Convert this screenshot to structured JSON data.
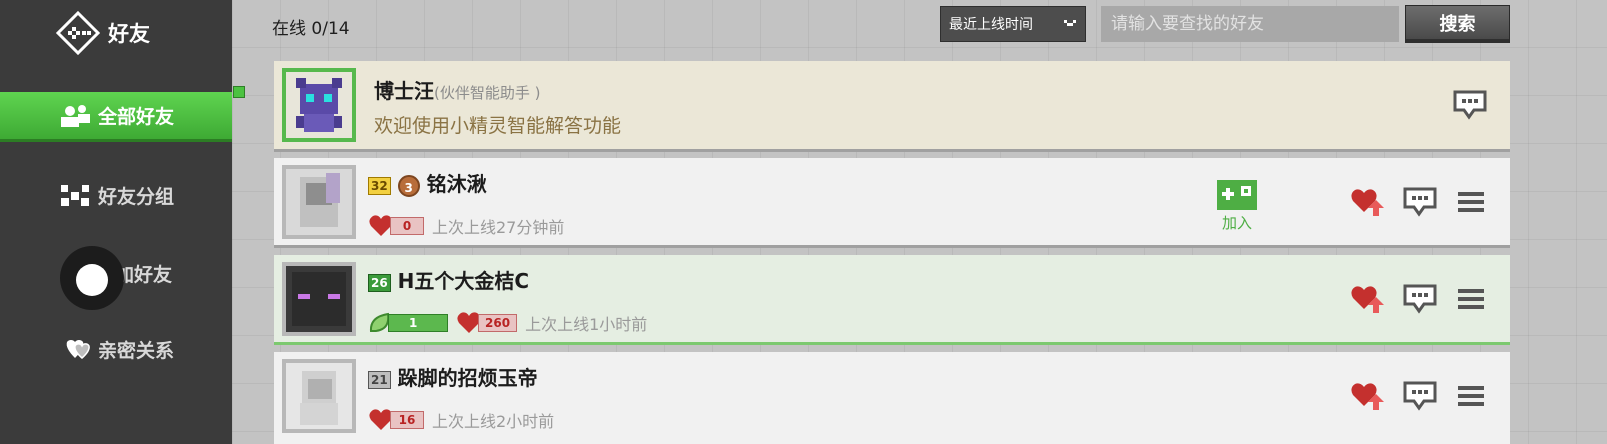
{
  "sidebar": {
    "title": "好友",
    "items": [
      {
        "label": "全部好友",
        "icon": "friends-icon",
        "active": true
      },
      {
        "label": "好友分组",
        "icon": "group-icon",
        "active": false
      },
      {
        "label": "添加好友",
        "icon": "add-friend-icon",
        "active": false
      },
      {
        "label": "亲密关系",
        "icon": "intimacy-hearts-icon",
        "active": false
      }
    ]
  },
  "topbar": {
    "online_count": "在线 0/14",
    "sort_selected": "最近上线时间",
    "search_placeholder": "请输入要查找的好友",
    "search_label": "搜索"
  },
  "bot": {
    "name": "博士汪",
    "subtitle": "(伙伴智能助手 )",
    "welcome": "欢迎使用小精灵智能解答功能"
  },
  "friends": [
    {
      "name": "铭沐湫",
      "level": "32",
      "rank": "3",
      "hearts": "0",
      "last_online": "上次上线27分钟前",
      "join_label": "加入"
    },
    {
      "name": "H五个大金桔C",
      "level": "26",
      "green_value": "1",
      "hearts": "260",
      "last_online": "上次上线1小时前"
    },
    {
      "name": "跺脚的招烦玉帝",
      "level": "21",
      "hearts": "16",
      "last_online": "上次上线2小时前"
    }
  ],
  "colors": {
    "sidebar_bg": "#3b3b3b",
    "active_green": "#4cc241",
    "heart_red": "#c4302e",
    "join_green": "#4eae44"
  }
}
